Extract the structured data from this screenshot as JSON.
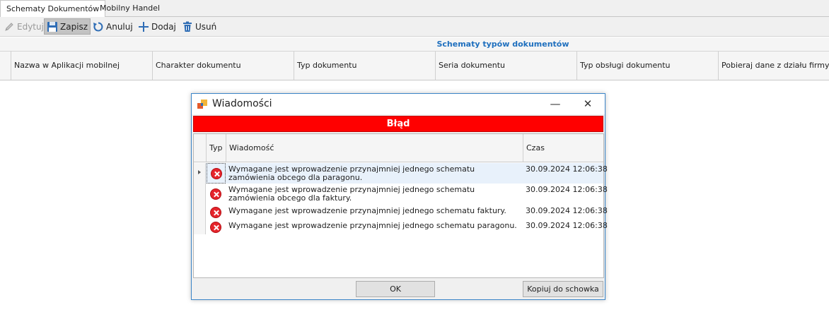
{
  "tabs": [
    {
      "label": "Schematy Dokumentów",
      "active": true
    },
    {
      "label": "Mobilny Handel",
      "active": false
    }
  ],
  "toolbar": {
    "edit_label": "Edytuj",
    "save_label": "Zapisz",
    "cancel_label": "Anuluj",
    "add_label": "Dodaj",
    "delete_label": "Usuń"
  },
  "grid": {
    "title": "Schematy typów dokumentów",
    "columns": [
      "Nazwa w Aplikacji mobilnej",
      "Charakter dokumentu",
      "Typ dokumentu",
      "Seria dokumentu",
      "Typ obsługi dokumentu",
      "Pobieraj dane z działu firmy"
    ]
  },
  "dialog": {
    "title": "Wiadomości",
    "banner": "Błąd",
    "columns": {
      "type": "Typ",
      "message": "Wiadomość",
      "time": "Czas"
    },
    "rows": [
      {
        "message": "Wymagane jest wprowadzenie przynajmniej jednego schematu zamówienia obcego dla paragonu.",
        "time": "30.09.2024 12:06:38"
      },
      {
        "message": "Wymagane jest wprowadzenie przynajmniej jednego schematu zamówienia obcego dla faktury.",
        "time": "30.09.2024 12:06:38"
      },
      {
        "message": "Wymagane jest wprowadzenie przynajmniej jednego schematu faktury.",
        "time": "30.09.2024 12:06:38"
      },
      {
        "message": "Wymagane jest wprowadzenie przynajmniej jednego schematu paragonu.",
        "time": "30.09.2024 12:06:38"
      }
    ],
    "ok_label": "OK",
    "copy_label": "Kopiuj do schowka",
    "minimize_glyph": "—",
    "close_glyph": "✕"
  },
  "colors": {
    "accent_blue": "#1e6fbe",
    "error_red": "#ff0000"
  }
}
